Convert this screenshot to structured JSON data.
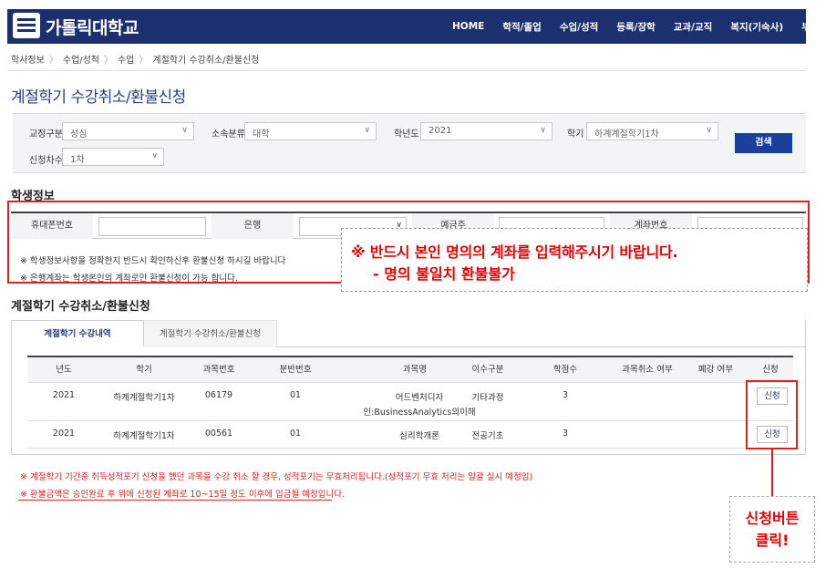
{
  "header": {
    "logo_text": "가톨릭대학교",
    "nav": [
      "HOME",
      "학적/졸업",
      "수업/성적",
      "등록/장학",
      "교과/교직",
      "복지(기숙사)",
      "부속기관"
    ]
  },
  "breadcrumb": [
    "학사정보",
    "수업/성적",
    "수업",
    "계절학기 수강취소/환불신청"
  ],
  "page_title": "계절학기 수강취소/환불신청",
  "search": {
    "campus_label": "교정구분",
    "campus_value": "성심",
    "dept_label": "소속분류",
    "dept_value": "대학",
    "year_label": "학년도",
    "year_value": "2021",
    "term_label": "학기",
    "term_value": "하계계절학기1차",
    "round_label": "신청차수",
    "round_value": "1차",
    "button": "검색"
  },
  "student_info": {
    "title": "학생정보",
    "phone_label": "휴대폰번호",
    "bank_label": "은행",
    "holder_label": "예금주",
    "account_label": "계좌번호",
    "notice1": "※ 학생정보사항을 정확한지 반드시 확인하신후 환불신청 하시길 바랍니다",
    "notice2": "※ 은행계좌는 학생본인의 계좌로만 환불신청이 가능 합니다."
  },
  "overlay_note": {
    "line1": "※ 반드시 본인 명의의 계좌를 입력해주시기 바랍니다.",
    "line2": "- 명의 불일치 환불불가"
  },
  "cancel_section": {
    "title": "계절학기 수강취소/환불신청",
    "tabs": [
      "계절학기 수강내역",
      "계절학기 수강취소/환불신청"
    ],
    "columns": [
      "년도",
      "학기",
      "과목번호",
      "분반번호",
      "과목명",
      "이수구분",
      "학점수",
      "과목취소 여부",
      "폐강 여부",
      "신청"
    ],
    "rows": [
      {
        "year": "2021",
        "term": "하계계절학기1차",
        "code": "06179",
        "section": "01",
        "name_l1": "어드벤처디자",
        "name_l2": "인:BusinessAnalytics의이해",
        "type": "기타과정",
        "credits": "3",
        "apply": "신청"
      },
      {
        "year": "2021",
        "term": "하계계절학기1차",
        "code": "00561",
        "section": "01",
        "name_l1": "심리학개론",
        "name_l2": "",
        "type": "전공기초",
        "credits": "3",
        "apply": "신청"
      }
    ]
  },
  "footer_notes": [
    "※ 계절학기 기간중 취득성적포기 신청을 했던 과목을 수강 취소 할 경우, 성적포기는 무효처리됩니다.(성적포기 무효 처리는 일괄 실시 예정임)",
    "※ 환불금액은 승인완료 후 위에 신청된 계좌로 10~15일 정도 이후에 입금될 예정입니다."
  ],
  "callout": {
    "line1": "신청버튼",
    "line2": "클릭!"
  },
  "colors": {
    "brand": "#1c2f6e",
    "accent": "#1a3f9c",
    "highlight": "#e02020"
  }
}
